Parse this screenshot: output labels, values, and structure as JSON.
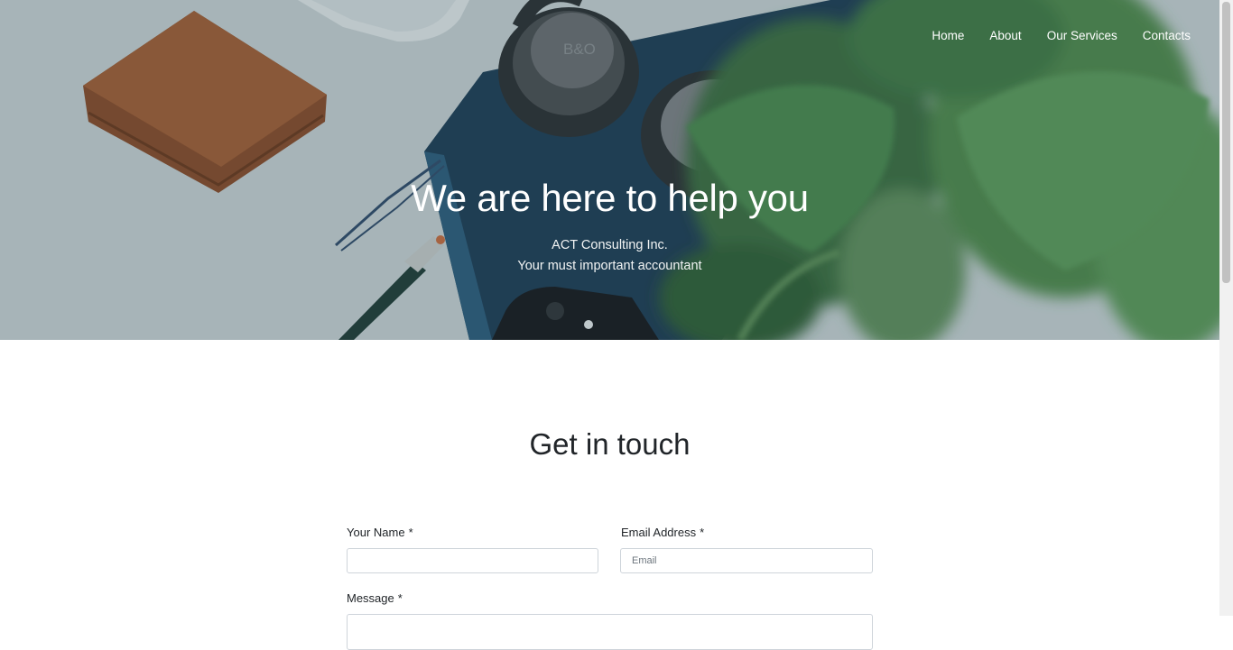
{
  "nav": {
    "items": [
      {
        "label": "Home"
      },
      {
        "label": "About"
      },
      {
        "label": "Our Services"
      },
      {
        "label": "Contacts"
      }
    ]
  },
  "hero": {
    "title": "We are here to help you",
    "company": "ACT Consulting Inc.",
    "tagline": "Your must important accountant",
    "overlay_color": "#2e4a55",
    "headphone_logo": "B&O"
  },
  "contact": {
    "title": "Get in touch",
    "name_label": "Your Name",
    "name_required": "*",
    "email_label": "Email Address",
    "email_required": "*",
    "email_placeholder": "Email",
    "message_label": "Message",
    "message_required": "*"
  }
}
